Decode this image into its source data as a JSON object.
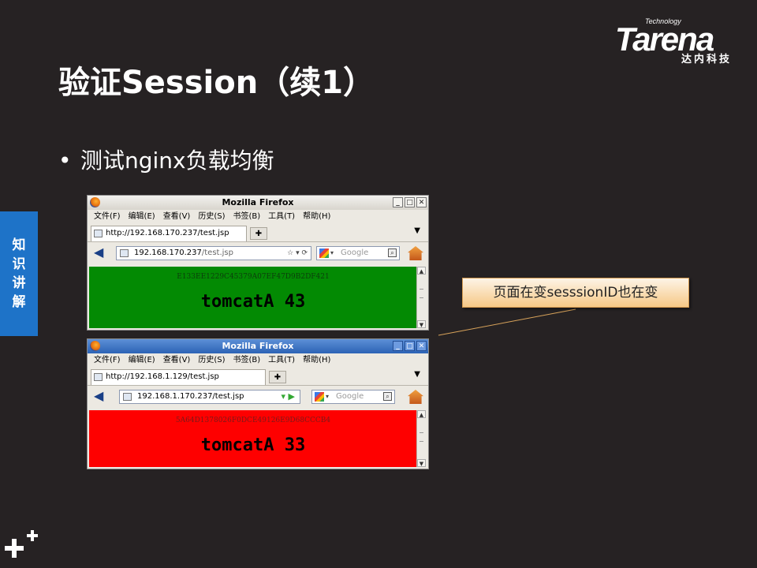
{
  "logo": {
    "tagline": "Technology",
    "brand": "Tarena",
    "cn": "达内科技"
  },
  "slide": {
    "title": "验证Session（续1）",
    "bullet": "测试nginx负载均衡",
    "side_tab": [
      "知",
      "识",
      "讲",
      "解"
    ],
    "callout": "页面在变sesssionID也在变"
  },
  "window1": {
    "title": "Mozilla Firefox",
    "menu": [
      "文件(F)",
      "编辑(E)",
      "查看(V)",
      "历史(S)",
      "书签(B)",
      "工具(T)",
      "帮助(H)"
    ],
    "tab": "http://192.168.170.237/test.jsp",
    "url_host": "192.168.170.237",
    "url_path": "/test.jsp",
    "search_placeholder": "Google",
    "session_id": "E133EE1229C45379A07EF47D9B2DF421",
    "counter": "tomcatA 43",
    "content_color": "#038a03"
  },
  "window2": {
    "title": "Mozilla Firefox",
    "menu": [
      "文件(F)",
      "编辑(E)",
      "查看(V)",
      "历史(S)",
      "书签(B)",
      "工具(T)",
      "帮助(H)"
    ],
    "tab": "http://192.168.1.129/test.jsp",
    "url": "192.168.1.170.237/test.jsp",
    "search_placeholder": "Google",
    "session_id": "5A64D1378026F0DCE49126E9D68CCCB4",
    "counter": "tomcatA 33",
    "content_color": "#fe0000"
  }
}
